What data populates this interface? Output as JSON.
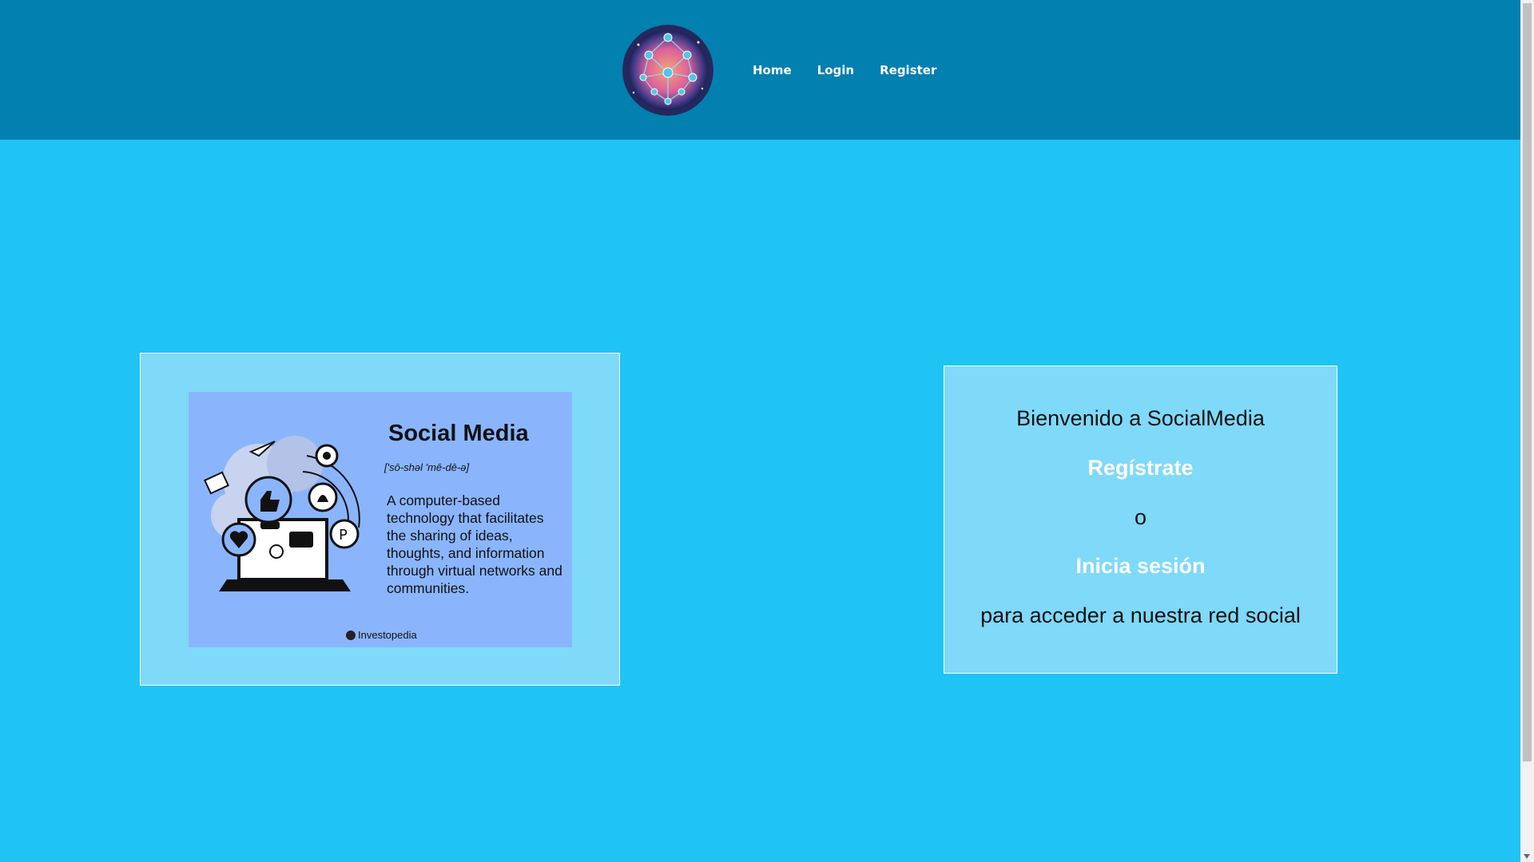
{
  "nav": {
    "logo_icon": "social-network-globe-icon",
    "items": [
      {
        "label": "Home"
      },
      {
        "label": "Login"
      },
      {
        "label": "Register"
      }
    ]
  },
  "image_card": {
    "title": "Social Media",
    "phonetic": "['sō-shəl 'mē-dē-ə]",
    "definition": "A computer-based technology that facilitates the sharing of ideas, thoughts, and information through virtual networks and communities.",
    "brand": "Investopedia",
    "icons": [
      "laptop-icon",
      "thumbs-up-icon",
      "heart-icon",
      "twitter-icon",
      "snapchat-icon",
      "pinterest-icon",
      "envelope-icon",
      "paper-plane-icon",
      "chat-icon",
      "smiley-icon"
    ]
  },
  "welcome": {
    "greeting": "Bienvenido a SocialMedia",
    "register_link": "Regístrate",
    "or_text": "o",
    "login_link": "Inicia sesión",
    "tagline": "para acceder a nuestra red social"
  },
  "colors": {
    "header_bg": "#0280b0",
    "page_bg": "#1fc4f5",
    "card_bg": "#7fd9f9",
    "image_bg": "#8ab5fd"
  }
}
